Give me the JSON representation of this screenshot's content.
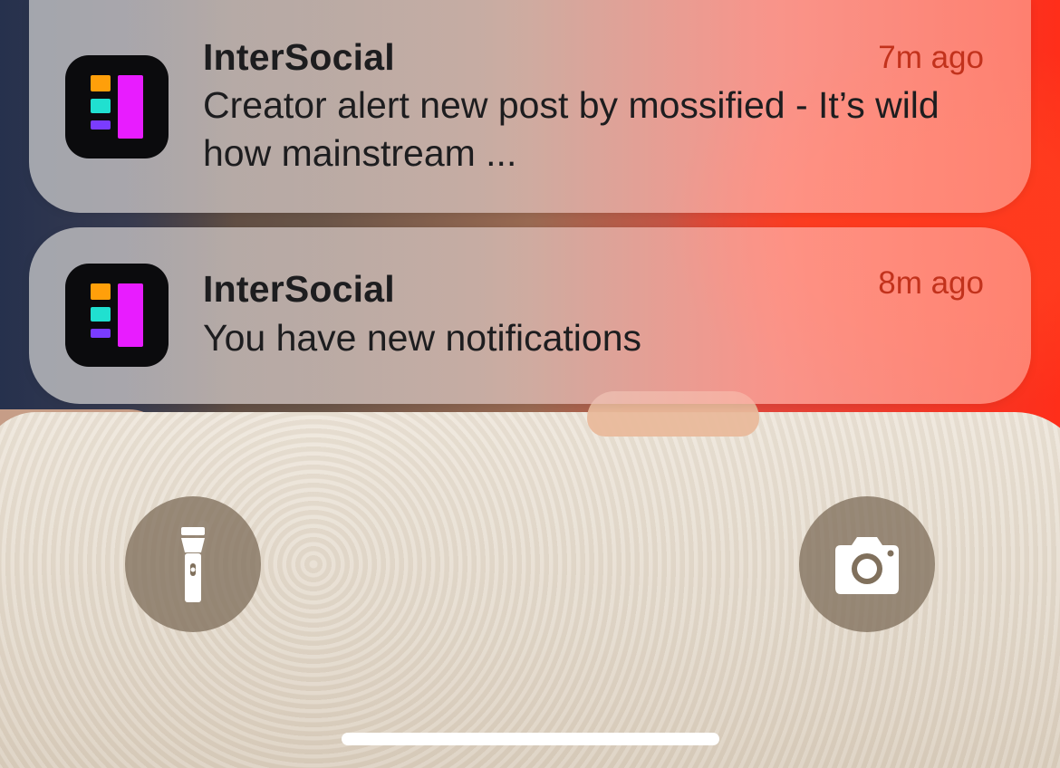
{
  "notifications": [
    {
      "app_name": "InterSocial",
      "time": "7m ago",
      "body": "Creator alert new post by mossified - It’s wild how mainstream ..."
    },
    {
      "app_name": "InterSocial",
      "time": "8m ago",
      "body": "You have new notifications"
    }
  ],
  "icons": {
    "app_icon": "intersocial-app-icon",
    "flashlight": "flashlight-icon",
    "camera": "camera-icon"
  },
  "colors": {
    "time_text": "#c2321c",
    "app_icon_orange": "#ff9f0a",
    "app_icon_cyan": "#20e0d0",
    "app_icon_purple": "#7a3cff",
    "app_icon_magenta": "#e81cff",
    "control_circle": "#80705c"
  }
}
